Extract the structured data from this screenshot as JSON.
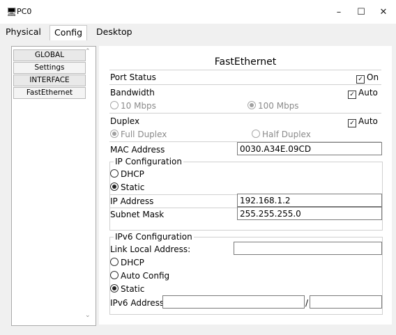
{
  "window": {
    "title": "PC0",
    "minimize": "–",
    "maximize": "☐",
    "close": "✕",
    "app_icon": "pc-icon"
  },
  "tabs": [
    "Physical",
    "Config",
    "Desktop"
  ],
  "active_tab": "Config",
  "sidebar": {
    "items": [
      {
        "label": "GLOBAL"
      },
      {
        "label": "Settings"
      },
      {
        "label": "INTERFACE"
      },
      {
        "label": "FastEthernet"
      }
    ]
  },
  "main": {
    "title": "FastEthernet",
    "port_status": {
      "label": "Port Status",
      "on_label": "On",
      "on_checked": true
    },
    "bandwidth": {
      "label": "Bandwidth",
      "auto_label": "Auto",
      "auto_checked": true,
      "opt_10": "10 Mbps",
      "opt_100": "100 Mbps",
      "selected": "100 Mbps"
    },
    "duplex": {
      "label": "Duplex",
      "auto_label": "Auto",
      "auto_checked": true,
      "opt_full": "Full Duplex",
      "opt_half": "Half Duplex",
      "selected": "Full Duplex"
    },
    "mac": {
      "label": "MAC Address",
      "value": "0030.A34E.09CD"
    },
    "ip_config": {
      "legend": "IP Configuration",
      "dhcp": "DHCP",
      "static": "Static",
      "selected": "Static",
      "ip_label": "IP Address",
      "ip_value": "192.168.1.2",
      "mask_label": "Subnet Mask",
      "mask_value": "255.255.255.0"
    },
    "ipv6_config": {
      "legend": "IPv6 Configuration",
      "link_local_label": "Link Local Address:",
      "link_local_value": "",
      "dhcp": "DHCP",
      "auto": "Auto Config",
      "static": "Static",
      "selected": "Static",
      "addr_label": "IPv6 Address",
      "addr_value": "",
      "prefix_sep": "/",
      "prefix_value": ""
    }
  }
}
